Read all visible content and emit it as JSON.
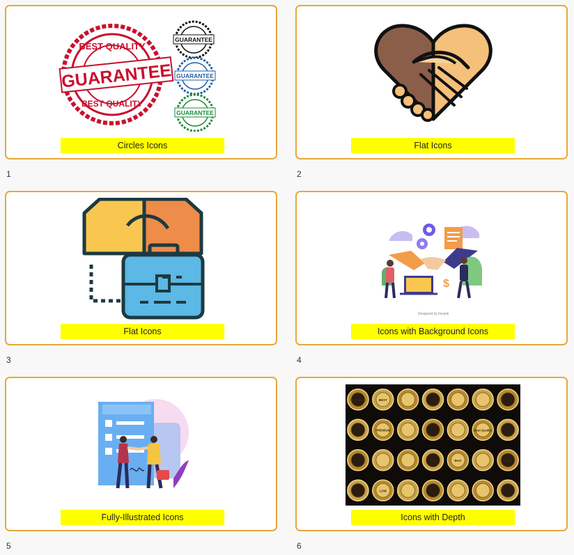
{
  "slides": [
    {
      "number": "1",
      "caption": "Circles Icons",
      "thumbnail": "guarantee-seal-badges"
    },
    {
      "number": "2",
      "caption": "Flat Icons",
      "thumbnail": "handshake-icon"
    },
    {
      "number": "3",
      "caption": "Flat Icons",
      "thumbnail": "handshake-briefcase-icon"
    },
    {
      "number": "4",
      "caption": "Icons with Background Icons",
      "thumbnail": "business-handshake-illustration"
    },
    {
      "number": "5",
      "caption": "Fully-Illustrated Icons",
      "thumbnail": "contract-agreement-illustration"
    },
    {
      "number": "6",
      "caption": "Icons with Depth",
      "thumbnail": "gold-badges-collection"
    }
  ],
  "badges": {
    "big_top": "BEST QUALITY",
    "big_mid": "GUARANTEE",
    "big_bottom": "BEST QUALITY",
    "small": "GUARANTEE"
  },
  "gold_badges": [
    "PREMIUM",
    "BEST",
    "",
    "",
    "",
    "",
    "",
    "",
    "PREMIUM",
    "",
    "",
    "",
    "Best Quality",
    "",
    "",
    "",
    "",
    "BIG",
    "Best",
    "",
    "BEST",
    "",
    "LOW",
    "",
    "",
    "",
    "",
    ""
  ],
  "freepik_credit": "Designed by freepik",
  "colors": {
    "border": "#e8a838",
    "caption_bg": "#ffff00",
    "badge_red": "#c8102e",
    "badge_blue": "#1f5fa8",
    "badge_green": "#1b8a3a"
  }
}
